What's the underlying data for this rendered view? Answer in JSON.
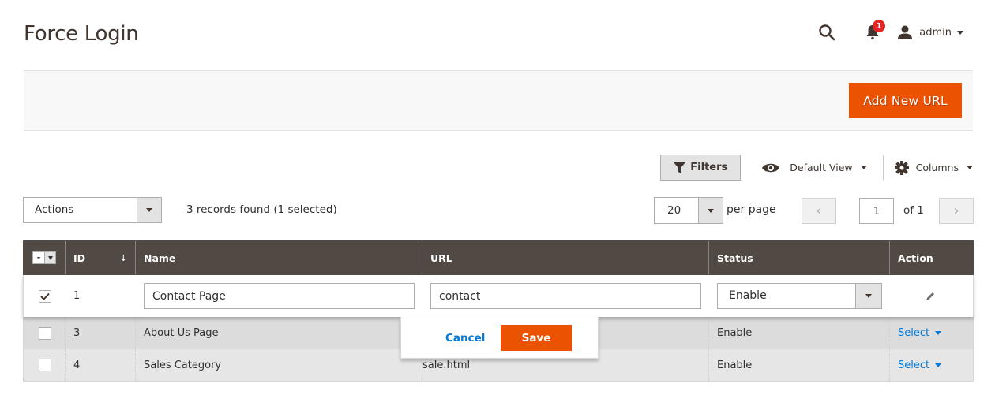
{
  "page": {
    "title": "Force Login"
  },
  "header": {
    "notifications_count": "1",
    "user_name": "admin",
    "icons": {
      "search": "search-icon",
      "notifications": "bell-icon",
      "user": "user-icon"
    }
  },
  "action_bar": {
    "add_button_label": "Add New URL",
    "accent_color": "#eb5202"
  },
  "toolbar": {
    "filters_label": "Filters",
    "view_label": "Default View",
    "columns_label": "Columns"
  },
  "grid_controls": {
    "actions_label": "Actions",
    "records_found": "3 records found (1 selected)",
    "per_page_value": "20",
    "per_page_label": "per page",
    "current_page": "1",
    "total_pages_label": "of 1",
    "prev_label": "‹",
    "next_label": "›"
  },
  "grid": {
    "columns": [
      {
        "key": "id",
        "label": "ID",
        "sort": "↓"
      },
      {
        "key": "name",
        "label": "Name"
      },
      {
        "key": "url",
        "label": "URL"
      },
      {
        "key": "status",
        "label": "Status"
      },
      {
        "key": "action",
        "label": "Action"
      }
    ],
    "mass_action_symbol": "-",
    "editing_row": {
      "id": "1",
      "checked": true,
      "name": "Contact Page",
      "url": "contact",
      "status": "Enable",
      "cancel_label": "Cancel",
      "save_label": "Save"
    },
    "rows": [
      {
        "id": "3",
        "name": "About Us Page",
        "url": "",
        "status": "Enable",
        "action": "Select",
        "checked": false
      },
      {
        "id": "4",
        "name": "Sales Category",
        "url": "sale.html",
        "status": "Enable",
        "action": "Select",
        "checked": false
      }
    ]
  }
}
